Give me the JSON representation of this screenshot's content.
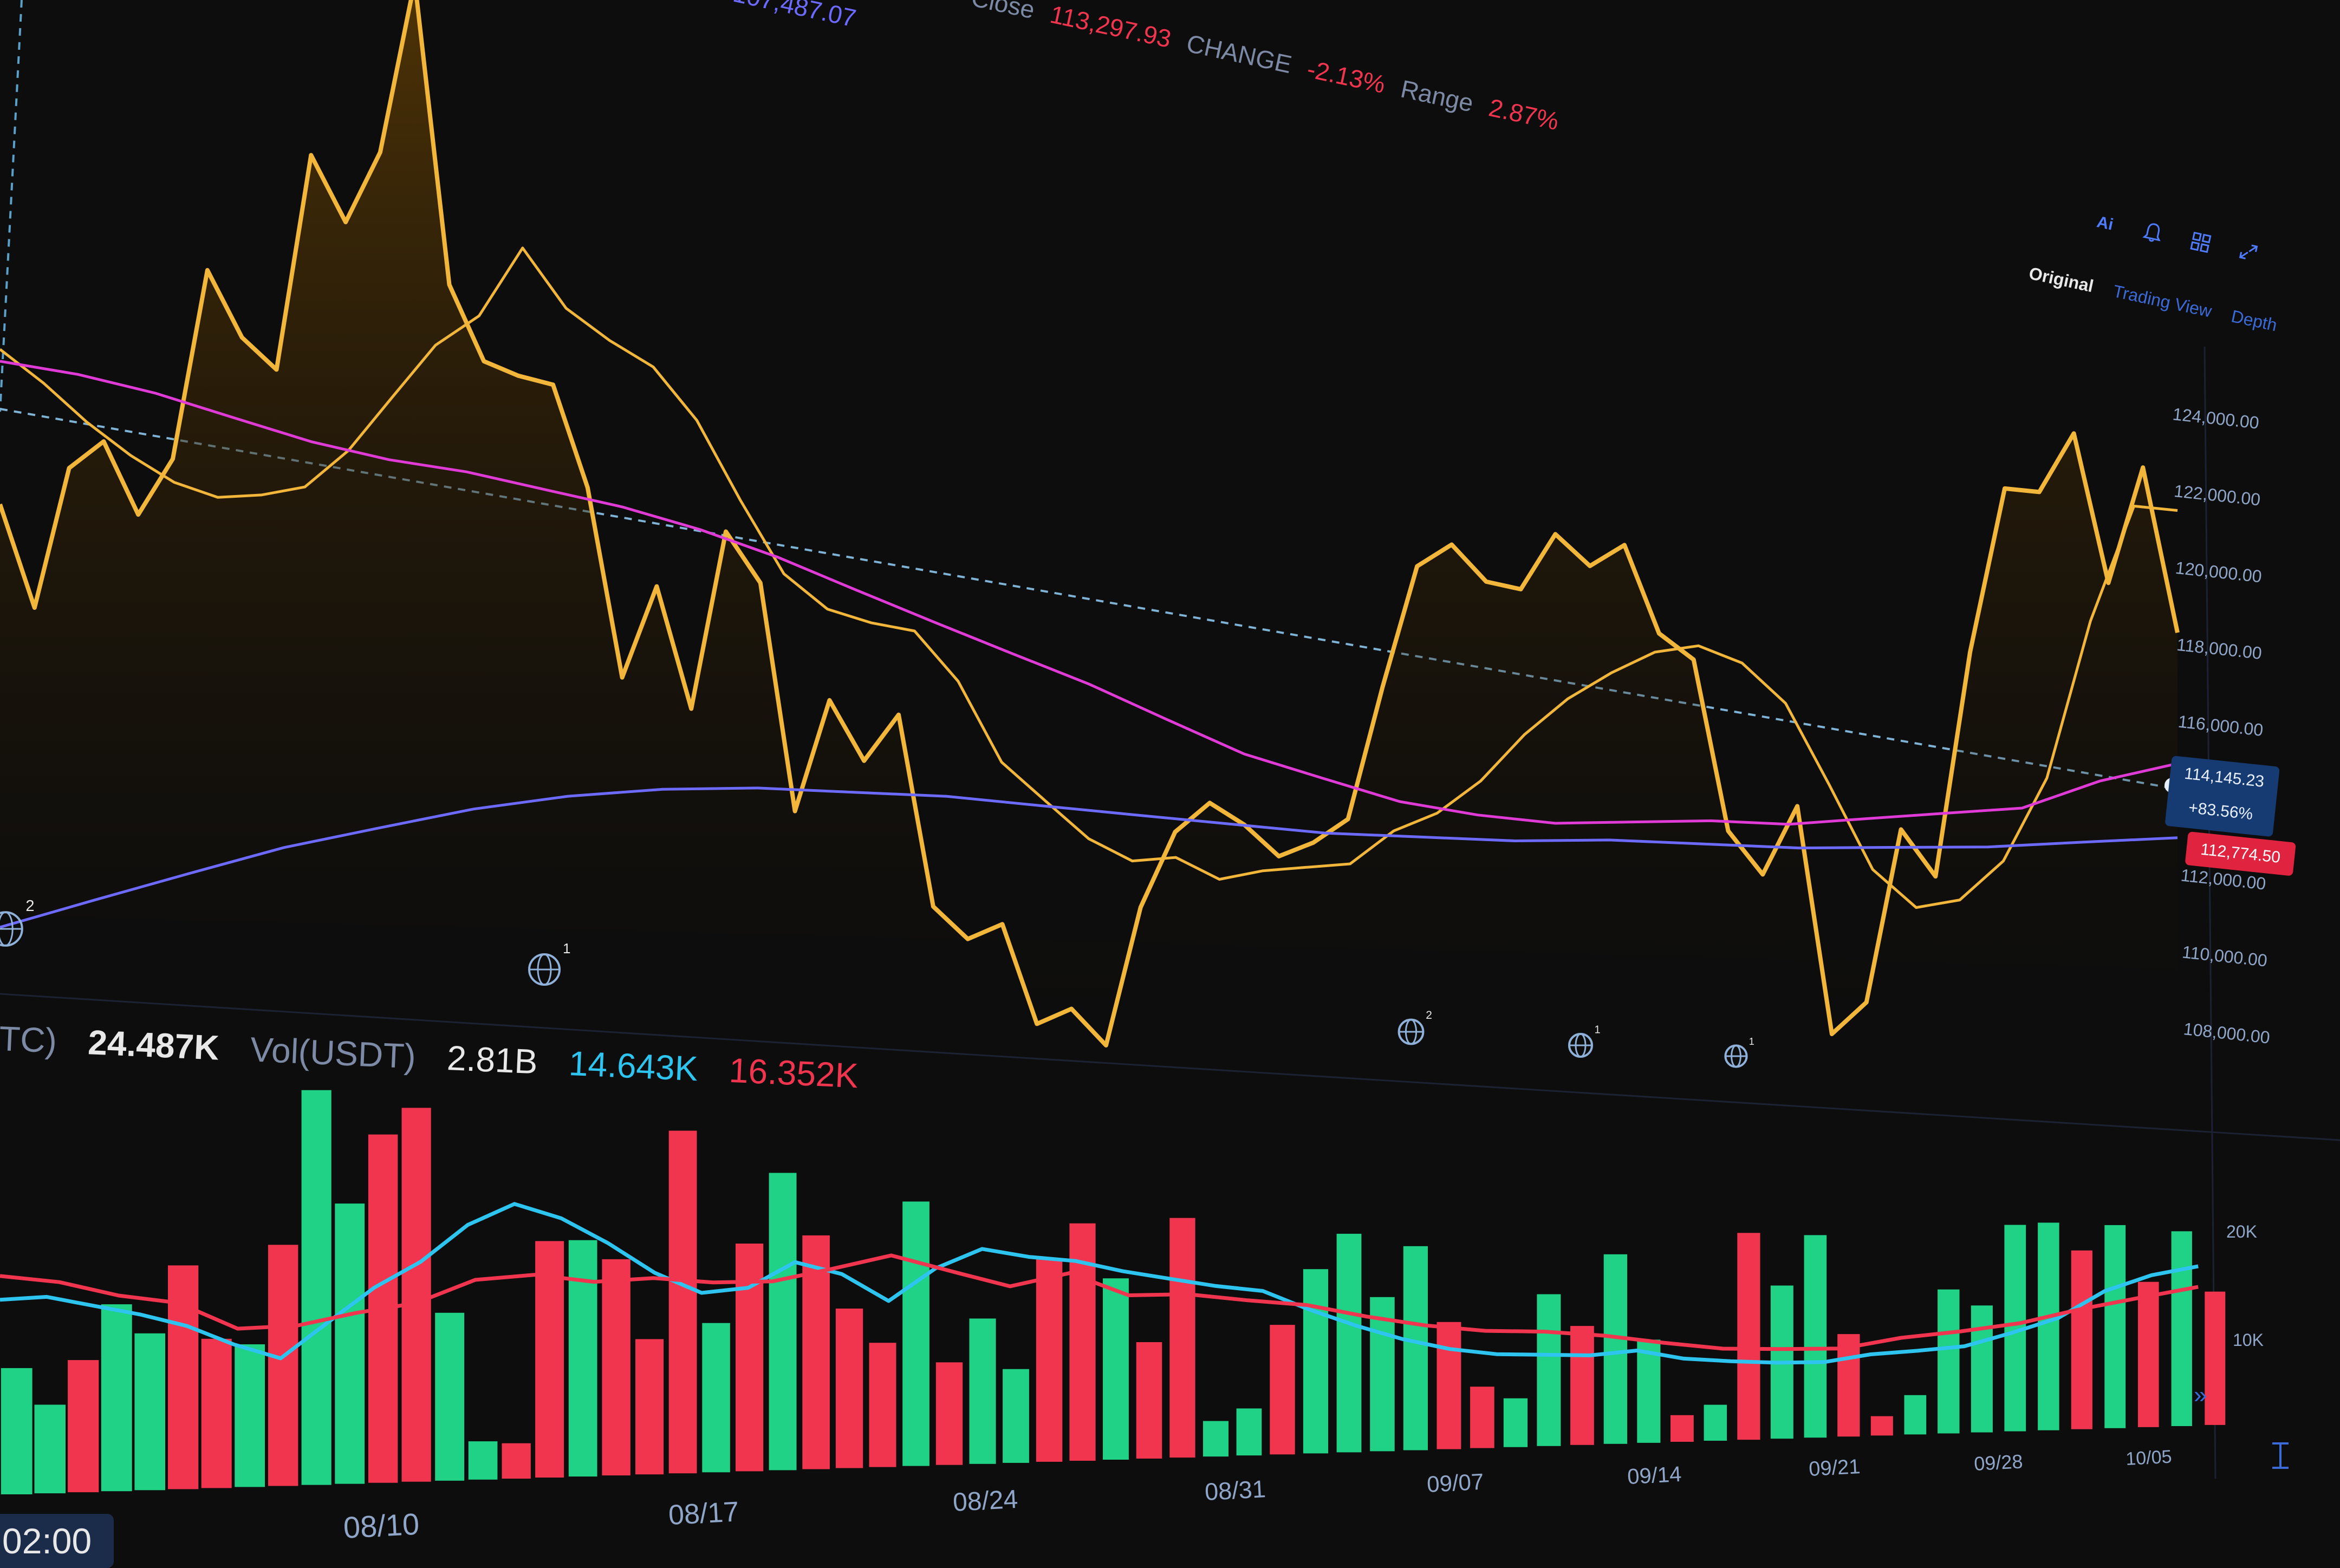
{
  "header": {
    "prev_value": "107,487.07",
    "close_label": "Close",
    "close_value": "113,297.93",
    "change_label": "CHANGE",
    "change_value": "-2.13%",
    "range_label": "Range",
    "range_value": "2.87%"
  },
  "toolbar": {
    "icons": [
      "ai-icon",
      "bell-icon",
      "layout-grid-icon",
      "expand-icon"
    ],
    "ai_glyph": "Ai"
  },
  "view_tabs": [
    "Original",
    "Trading View",
    "Depth"
  ],
  "price_boxes": {
    "current": "114,145.23",
    "current_change": "+83.56%",
    "last": "112,774.50"
  },
  "volume_legend": {
    "base_label": "TC)",
    "base_value": "24.487K",
    "quote_label": "Vol(USDT)",
    "quote_value": "2.81B",
    "ma1_value": "14.643K",
    "ma2_value": "16.352K"
  },
  "time_badge": "02:00",
  "event_markers": [
    "2",
    "1",
    "2",
    "1",
    "1"
  ],
  "colors": {
    "up": "#1fd286",
    "down": "#f2354f",
    "price_line": "#f2b63a",
    "ma_magenta": "#e03bd6",
    "ma_purple": "#6d6bff",
    "vol_ma_cyan": "#2ec4f0",
    "vol_ma_red": "#f2354f",
    "axis_text": "#8fa6c8"
  },
  "chart_data": [
    {
      "type": "line",
      "x_ticks": [
        "08/10",
        "08/17",
        "08/24",
        "08/31",
        "09/07",
        "09/14",
        "09/21",
        "09/28",
        "10/05"
      ],
      "y_ticks": [
        "124,000.00",
        "122,000.00",
        "120,000.00",
        "118,000.00",
        "116,000.00",
        "114,000.00",
        "112,000.00",
        "110,000.00",
        "108,000.00"
      ],
      "ylim": [
        107000,
        125000
      ],
      "series": [
        {
          "values": [
            116900,
            115200,
            117600,
            118100,
            116900,
            117900,
            121200,
            120100,
            119600,
            123400,
            122300,
            123600,
            126700,
            121400,
            120100,
            119900,
            119800,
            118000,
            114600,
            116300,
            114100,
            117400,
            116500,
            112300,
            114400,
            113300,
            114200,
            110600,
            110000,
            110300,
            108400,
            108700,
            108000,
            110700,
            112200,
            112800,
            112400,
            111800,
            112100,
            112600,
            115300,
            117800,
            118300,
            117600,
            117500,
            118700,
            118100,
            118600,
            116800,
            116300,
            112700,
            111800,
            113300,
            108400,
            109100,
            112900,
            111900,
            116900,
            120600,
            120600,
            122000,
            118700,
            121400,
            117700
          ]
        },
        {
          "values": [
            119500,
            119000,
            118400,
            117900,
            117500,
            117300,
            117400,
            117600,
            118300,
            119300,
            120300,
            120900,
            122200,
            121200,
            120700,
            120300,
            119400,
            118000,
            116700,
            116100,
            115900,
            115800,
            114900,
            113400,
            112700,
            112000,
            111600,
            111700,
            111300,
            111500,
            111600,
            111700,
            112400,
            112800,
            113500,
            114500,
            115300,
            115900,
            116400,
            116600,
            116300,
            115500,
            113800,
            112000,
            111200,
            111400,
            112300,
            114200,
            117800,
            120500,
            120500
          ]
        },
        {
          "values": [
            119300,
            119200,
            119000,
            118700,
            118400,
            118200,
            118100,
            117900,
            117700,
            117400,
            117000,
            116500,
            116000,
            115500,
            115000,
            114400,
            113800,
            113400,
            113000,
            112800,
            112700,
            112800,
            112900,
            112900,
            113100,
            113300,
            113500,
            114200,
            114700
          ]
        },
        {
          "values": [
            109800,
            110300,
            110800,
            111300,
            111700,
            112100,
            112400,
            112600,
            112700,
            112700,
            112700,
            112600,
            112500,
            112400,
            112300,
            112300,
            112300,
            112400,
            112400,
            112400,
            112500,
            112600,
            112800,
            113000
          ]
        }
      ]
    },
    {
      "type": "bar",
      "x_ticks": [
        "08/10",
        "08/17",
        "08/24",
        "08/31",
        "09/07",
        "09/14",
        "09/21",
        "09/28",
        "10/05"
      ],
      "y_ticks": [
        "20K",
        "10K"
      ],
      "ylim": [
        0,
        28000
      ],
      "values": [
        8500,
        6000,
        9000,
        12800,
        10800,
        15500,
        10400,
        10000,
        17000,
        28000,
        20000,
        25000,
        27000,
        12200,
        2800,
        2600,
        17500,
        17600,
        16200,
        10200,
        26000,
        11400,
        17500,
        23000,
        18200,
        12500,
        9800,
        21000,
        8200,
        11700,
        7600,
        16600,
        19500,
        15000,
        9700,
        20100,
        3000,
        4000,
        11100,
        15900,
        19000,
        13500,
        18000,
        11300,
        5500,
        4400,
        13800,
        10900,
        17500,
        9600,
        2500,
        3400,
        19700,
        14700,
        19600,
        10000,
        1900,
        3900,
        14400,
        12800,
        21000,
        21300,
        18500,
        21200,
        15300,
        20700,
        14300
      ],
      "directions": [
        "up",
        "up",
        "down",
        "up",
        "up",
        "down",
        "down",
        "up",
        "down",
        "up",
        "up",
        "down",
        "down",
        "up",
        "up",
        "down",
        "down",
        "up",
        "down",
        "down",
        "down",
        "up",
        "down",
        "up",
        "down",
        "down",
        "down",
        "up",
        "down",
        "up",
        "up",
        "down",
        "down",
        "up",
        "down",
        "down",
        "up",
        "up",
        "down",
        "up",
        "up",
        "up",
        "up",
        "down",
        "down",
        "up",
        "up",
        "down",
        "up",
        "up",
        "down",
        "up",
        "down",
        "up",
        "up",
        "down",
        "down",
        "up",
        "up",
        "up",
        "up",
        "up",
        "down",
        "up",
        "down",
        "up",
        "down"
      ],
      "series": [
        {
          "values": [
            13100,
            13300,
            12700,
            12100,
            11300,
            10000,
            9000,
            11500,
            14000,
            15900,
            18600,
            20200,
            19200,
            17400,
            15200,
            13700,
            14100,
            16100,
            15200,
            13100,
            15700,
            17300,
            16700,
            16400,
            15600,
            15000,
            14400,
            14000,
            12400,
            11000,
            9800,
            8900,
            8400,
            8300,
            8200,
            8600,
            7800,
            7500,
            7300,
            7300,
            8000,
            8300,
            8700,
            10000,
            11500,
            14300,
            16000,
            17000
          ]
        },
        {
          "values": [
            14700,
            14300,
            13400,
            12900,
            11100,
            11300,
            12200,
            12900,
            14600,
            15000,
            14500,
            14800,
            14500,
            14600,
            15600,
            16700,
            15500,
            14300,
            15400,
            13600,
            13700,
            13200,
            12800,
            11800,
            11000,
            10500,
            10400,
            10000,
            9300,
            8700,
            8600,
            8600,
            9600,
            10200,
            11000,
            12400,
            13600,
            14800
          ]
        }
      ]
    }
  ]
}
